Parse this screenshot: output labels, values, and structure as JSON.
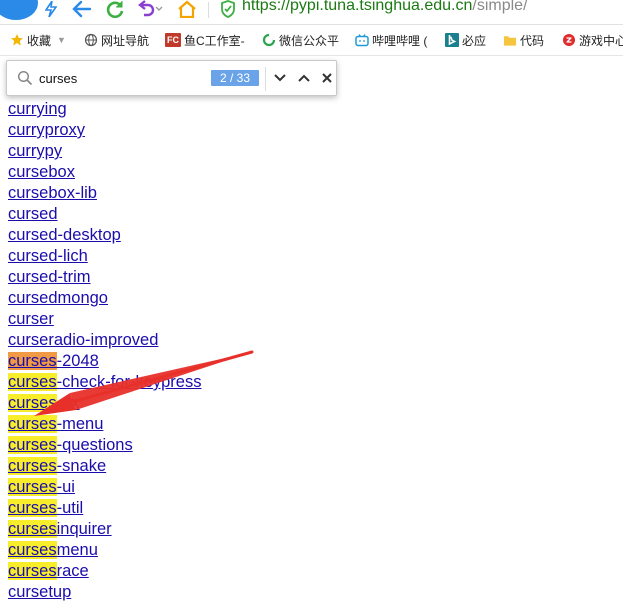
{
  "address_bar": {
    "url_host": "https://pypi.tuna.tsinghua.edu.cn",
    "url_path": "/simple/"
  },
  "bookmarks": [
    {
      "label": "收藏",
      "icon": "star-icon"
    },
    {
      "label": "网址导航",
      "icon": "globe-icon"
    },
    {
      "label": "鱼C工作室-",
      "icon": "fc-logo-icon",
      "icon_text": "FC"
    },
    {
      "label": "微信公众平",
      "icon": "wechat-icon"
    },
    {
      "label": "哔哩哔哩 (",
      "icon": "bilibili-icon"
    },
    {
      "label": "必应",
      "icon": "bing-icon"
    },
    {
      "label": "代码",
      "icon": "folder-icon"
    },
    {
      "label": "游戏中心",
      "icon": "game-center-icon"
    }
  ],
  "find_bar": {
    "query": "curses",
    "count": "2 / 33"
  },
  "packages": [
    {
      "pre": "currying",
      "match": "",
      "post": ""
    },
    {
      "pre": "curryproxy",
      "match": "",
      "post": ""
    },
    {
      "pre": "currypy",
      "match": "",
      "post": ""
    },
    {
      "pre": "cursebox",
      "match": "",
      "post": ""
    },
    {
      "pre": "cursebox-lib",
      "match": "",
      "post": ""
    },
    {
      "pre": "cursed",
      "match": "",
      "post": ""
    },
    {
      "pre": "cursed-desktop",
      "match": "",
      "post": ""
    },
    {
      "pre": "cursed-lich",
      "match": "",
      "post": ""
    },
    {
      "pre": "cursed-trim",
      "match": "",
      "post": ""
    },
    {
      "pre": "cursedmongo",
      "match": "",
      "post": ""
    },
    {
      "pre": "curser",
      "match": "",
      "post": ""
    },
    {
      "pre": "curseradio-improved",
      "match": "",
      "post": ""
    },
    {
      "pre": "",
      "match": "curses",
      "post": "-2048",
      "active": true
    },
    {
      "pre": "",
      "match": "curses",
      "post": "-check-for-keypress"
    },
    {
      "pre": "",
      "match": "curses",
      "post": "-ex"
    },
    {
      "pre": "",
      "match": "curses",
      "post": "-menu"
    },
    {
      "pre": "",
      "match": "curses",
      "post": "-questions"
    },
    {
      "pre": "",
      "match": "curses",
      "post": "-snake"
    },
    {
      "pre": "",
      "match": "curses",
      "post": "-ui"
    },
    {
      "pre": "",
      "match": "curses",
      "post": "-util"
    },
    {
      "pre": "",
      "match": "curses",
      "post": "inquirer"
    },
    {
      "pre": "",
      "match": "curses",
      "post": "menu"
    },
    {
      "pre": "",
      "match": "curses",
      "post": "race"
    },
    {
      "pre": "cursetup",
      "match": "",
      "post": ""
    }
  ],
  "colors": {
    "link": "#1a0dab",
    "highlight": "#f7ed2a",
    "active_highlight": "#f09a45",
    "annotation_arrow": "#e8302a",
    "url_green": "#1b7a12"
  }
}
